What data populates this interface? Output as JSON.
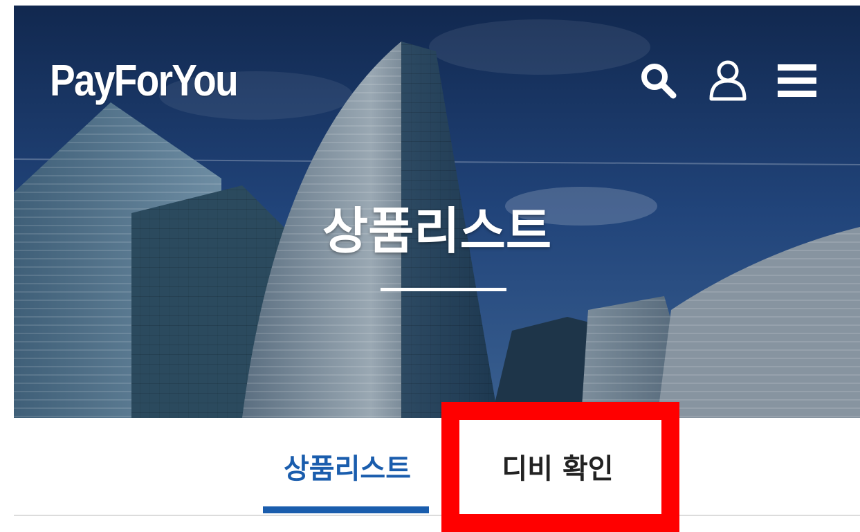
{
  "header": {
    "logo": "PayForYou",
    "icons": [
      "search-icon",
      "user-icon",
      "menu-icon"
    ]
  },
  "hero": {
    "title": "상품리스트"
  },
  "tabs": [
    {
      "label": "상품리스트",
      "active": true
    },
    {
      "label": "디비 확인",
      "active": false
    }
  ],
  "colors": {
    "accent": "#1a5dad",
    "highlight": "#ff0000",
    "text_dark": "#222222"
  }
}
